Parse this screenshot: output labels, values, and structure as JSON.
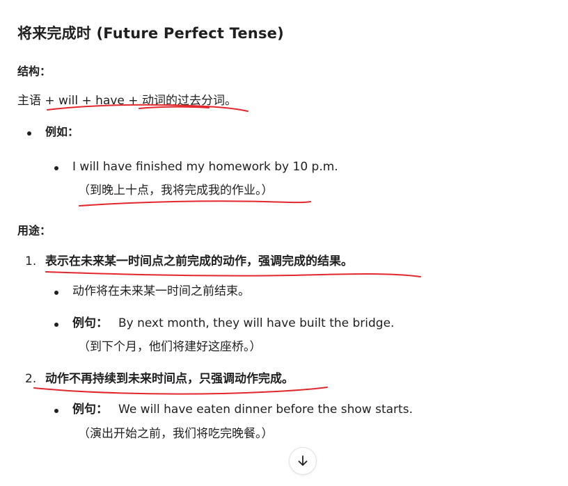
{
  "title": "将来完成时 (Future Perfect Tense)",
  "structure": {
    "label": "结构：",
    "formula": "主语 + will + have + 动词的过去分词。",
    "example_label": "例如：",
    "example_en": "I will have finished my homework by 10 p.m.",
    "example_zh": "（到晚上十点，我将完成我的作业。）"
  },
  "usage": {
    "label": "用途：",
    "items": [
      {
        "number": "1.",
        "heading": "表示在未来某一时间点之前完成的动作，强调完成的结果。",
        "note": "动作将在未来某一时间之前结束。",
        "example_label": "例句：",
        "example_en": "By next month, they will have built the bridge.",
        "example_zh": "（到下个月，他们将建好这座桥。）"
      },
      {
        "number": "2.",
        "heading": "动作不再持续到未来时间点，只强调动作完成。",
        "example_label": "例句：",
        "example_en": "We will have eaten dinner before the show starts.",
        "example_zh": "（演出开始之前，我们将吃完晚餐。）"
      }
    ]
  },
  "scroll_button": {
    "icon": "arrow-down-icon"
  },
  "colors": {
    "text": "#1f1f1f",
    "annotation_ink": "#e3262b"
  }
}
